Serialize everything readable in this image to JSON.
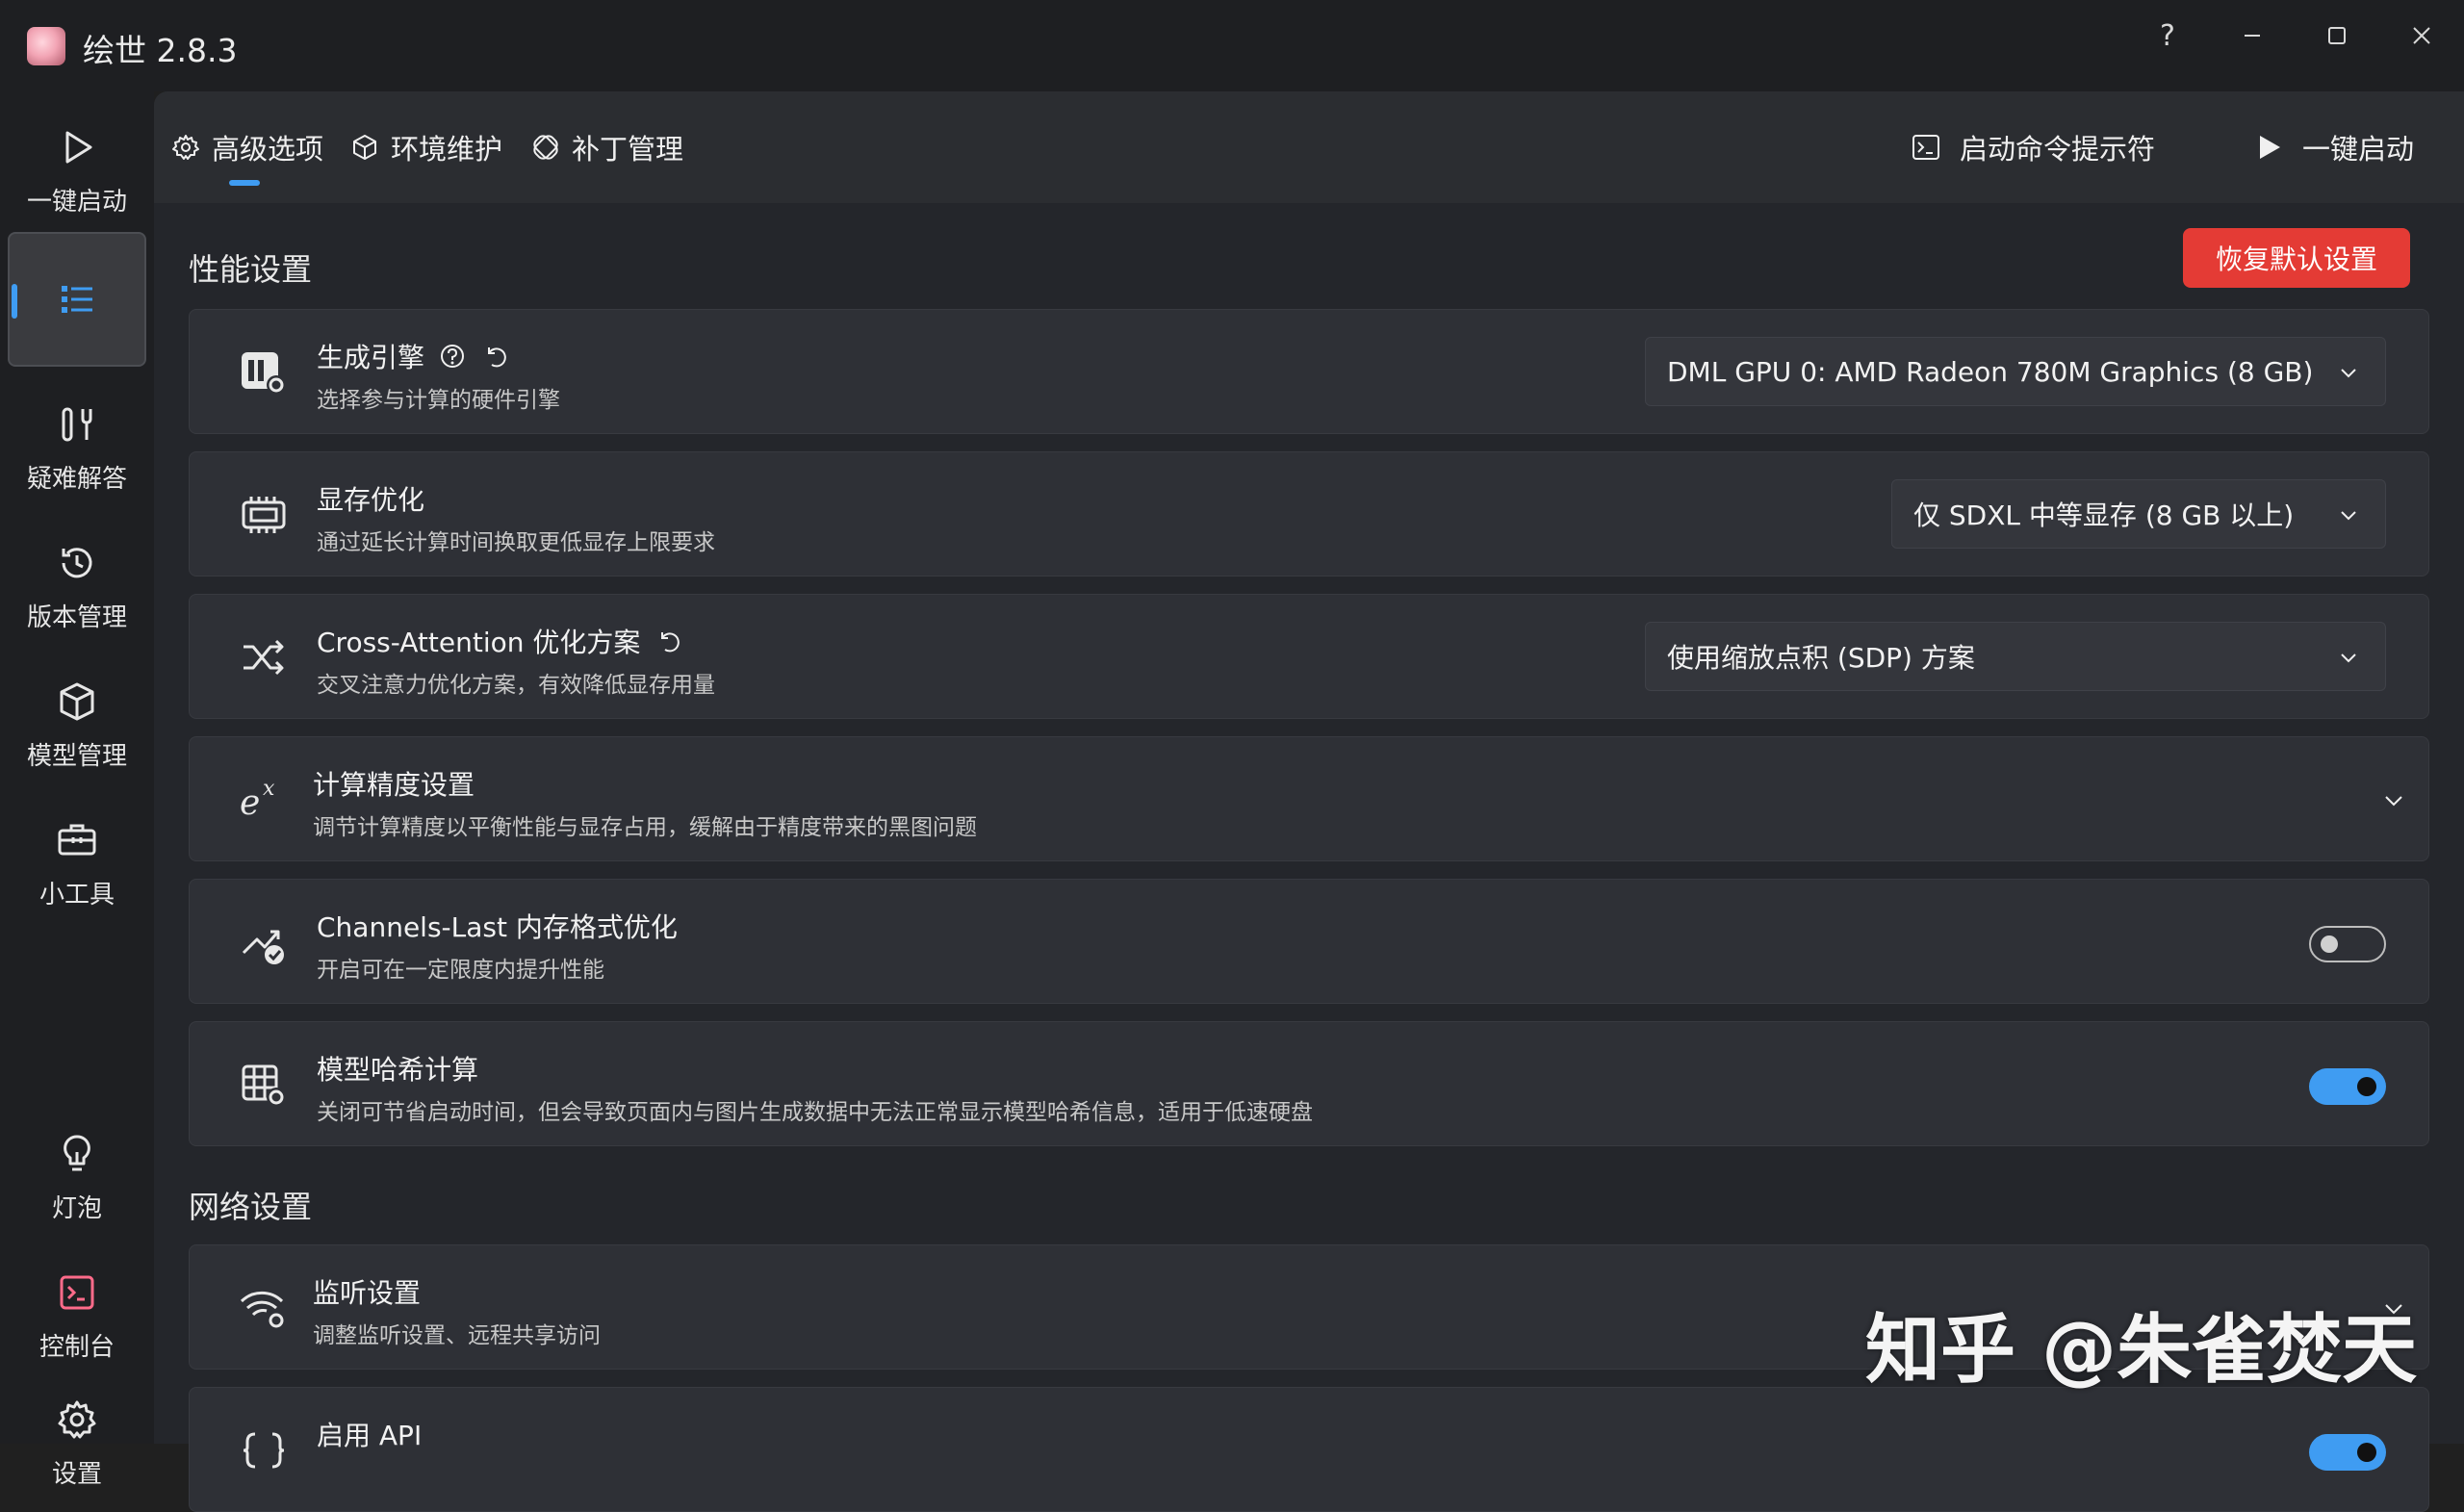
{
  "app": {
    "title": "绘世 2.8.3"
  },
  "window_controls": {
    "help": "?"
  },
  "nav": [
    {
      "label": "一键启动",
      "icon": "play-icon"
    },
    {
      "label": "",
      "icon": "list-icon",
      "active": true
    },
    {
      "label": "疑难解答",
      "icon": "tools-icon"
    },
    {
      "label": "版本管理",
      "icon": "history-icon"
    },
    {
      "label": "模型管理",
      "icon": "cube-icon"
    },
    {
      "label": "小工具",
      "icon": "toolbox-icon"
    },
    {
      "label": "灯泡",
      "icon": "lightbulb-icon"
    },
    {
      "label": "控制台",
      "icon": "console-icon"
    },
    {
      "label": "设置",
      "icon": "gear-icon"
    }
  ],
  "toolbar": {
    "tabs": [
      {
        "label": "高级选项",
        "icon": "gear-small-icon",
        "active": true
      },
      {
        "label": "环境维护",
        "icon": "cube-small-icon"
      },
      {
        "label": "补丁管理",
        "icon": "patch-icon"
      }
    ],
    "console_button": "启动命令提示符",
    "launch_button": "一键启动"
  },
  "performance": {
    "section_title": "性能设置",
    "reset_button": "恢复默认设置",
    "cards": [
      {
        "title": "生成引擎",
        "subtitle": "选择参与计算的硬件引擎",
        "value": "DML GPU 0: AMD Radeon 780M Graphics (8 GB)"
      },
      {
        "title": "显存优化",
        "subtitle": "通过延长计算时间换取更低显存上限要求",
        "value": "仅 SDXL 中等显存 (8 GB 以上)"
      },
      {
        "title": "Cross-Attention 优化方案",
        "subtitle": "交叉注意力优化方案，有效降低显存用量",
        "value": "使用缩放点积 (SDP) 方案"
      },
      {
        "title": "计算精度设置",
        "subtitle": "调节计算精度以平衡性能与显存占用，缓解由于精度带来的黑图问题"
      },
      {
        "title": "Channels-Last 内存格式优化",
        "subtitle": "开启可在一定限度内提升性能",
        "toggle": false
      },
      {
        "title": "模型哈希计算",
        "subtitle": "关闭可节省启动时间，但会导致页面内与图片生成数据中无法正常显示模型哈希信息，适用于低速硬盘",
        "toggle": true
      }
    ]
  },
  "network": {
    "section_title": "网络设置",
    "cards": [
      {
        "title": "监听设置",
        "subtitle": "调整监听设置、远程共享访问"
      },
      {
        "title": "启用 API",
        "toggle": true
      }
    ]
  },
  "watermark": "知乎 @朱雀焚天",
  "colors": {
    "accent": "#3f9cf2",
    "danger": "#e43b35",
    "background": "#24262b",
    "card": "#2e3036"
  }
}
